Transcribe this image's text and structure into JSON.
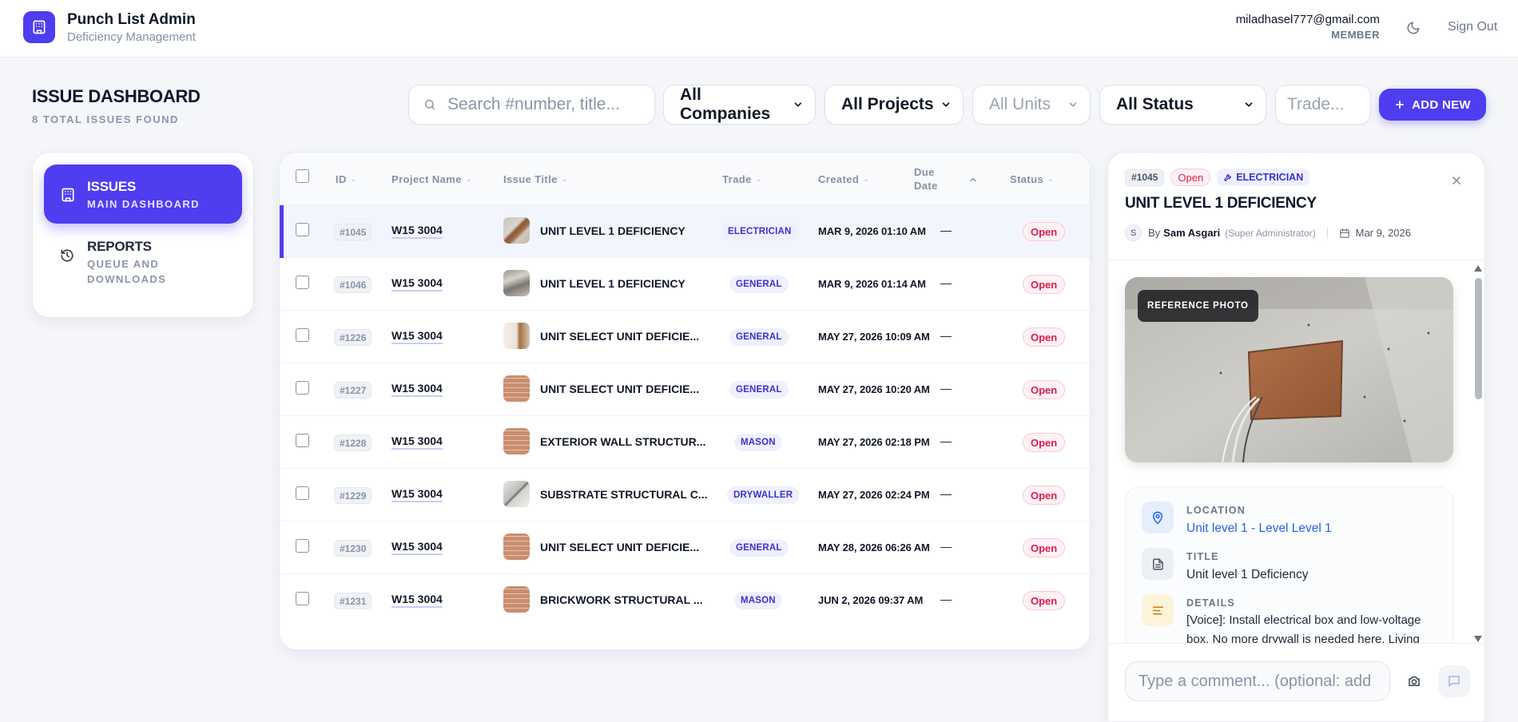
{
  "app": {
    "title": "Punch List Admin",
    "subtitle": "Deficiency Management",
    "user_email": "miladhasel777@gmail.com",
    "user_role": "MEMBER",
    "signout_label": "Sign Out"
  },
  "page": {
    "title": "ISSUE DASHBOARD",
    "count_label": "8 TOTAL ISSUES FOUND"
  },
  "filters": {
    "search_placeholder": "Search #number, title...",
    "companies": "All Companies",
    "projects": "All Projects",
    "units": "All Units",
    "status": "All Status",
    "trade_placeholder": "Trade...",
    "add_new_label": "ADD NEW"
  },
  "sidenav": {
    "items": [
      {
        "title": "ISSUES",
        "subtitle": "MAIN DASHBOARD",
        "icon": "building-icon",
        "active": true
      },
      {
        "title": "REPORTS",
        "subtitle": "QUEUE AND DOWNLOADS",
        "icon": "history-icon",
        "active": false
      }
    ]
  },
  "table": {
    "columns": {
      "id": "ID",
      "project": "Project Name",
      "title": "Issue Title",
      "trade": "Trade",
      "created": "Created",
      "due": "Due Date",
      "status": "Status"
    },
    "rows": [
      {
        "id": "#1045",
        "project": "W15 3004",
        "title": "UNIT LEVEL 1 DEFICIENCY",
        "trade": "ELECTRICIAN",
        "created": "MAR 9, 2026 01:10 AM",
        "due": "—",
        "status": "Open"
      },
      {
        "id": "#1046",
        "project": "W15 3004",
        "title": "UNIT LEVEL 1 DEFICIENCY",
        "trade": "GENERAL",
        "created": "MAR 9, 2026 01:14 AM",
        "due": "—",
        "status": "Open"
      },
      {
        "id": "#1226",
        "project": "W15 3004",
        "title": "UNIT SELECT UNIT DEFICIE...",
        "trade": "GENERAL",
        "created": "MAY 27, 2026 10:09 AM",
        "due": "—",
        "status": "Open"
      },
      {
        "id": "#1227",
        "project": "W15 3004",
        "title": "UNIT SELECT UNIT DEFICIE...",
        "trade": "GENERAL",
        "created": "MAY 27, 2026 10:20 AM",
        "due": "—",
        "status": "Open"
      },
      {
        "id": "#1228",
        "project": "W15 3004",
        "title": "EXTERIOR WALL STRUCTUR...",
        "trade": "MASON",
        "created": "MAY 27, 2026 02:18 PM",
        "due": "—",
        "status": "Open"
      },
      {
        "id": "#1229",
        "project": "W15 3004",
        "title": "SUBSTRATE STRUCTURAL C...",
        "trade": "DRYWALLER",
        "created": "MAY 27, 2026 02:24 PM",
        "due": "—",
        "status": "Open"
      },
      {
        "id": "#1230",
        "project": "W15 3004",
        "title": "UNIT SELECT UNIT DEFICIE...",
        "trade": "GENERAL",
        "created": "MAY 28, 2026 06:26 AM",
        "due": "—",
        "status": "Open"
      },
      {
        "id": "#1231",
        "project": "W15 3004",
        "title": "BRICKWORK STRUCTURAL ...",
        "trade": "MASON",
        "created": "JUN 2, 2026 09:37 AM",
        "due": "—",
        "status": "Open"
      }
    ]
  },
  "detail": {
    "id": "#1045",
    "status": "Open",
    "trade": "ELECTRICIAN",
    "title": "UNIT LEVEL 1 DEFICIENCY",
    "avatar_initial": "S",
    "by_label": "By",
    "author": "Sam Asgari",
    "author_role": "(Super Administrator)",
    "date": "Mar 9, 2026",
    "photo_label": "REFERENCE PHOTO",
    "location_label": "LOCATION",
    "location_value": "Unit level 1 - Level Level 1",
    "title_label": "TITLE",
    "title_value": "Unit level 1 Deficiency",
    "details_label": "DETAILS",
    "details_value": "[Voice]: Install electrical box and low-voltage box. No more drywall is needed here. Living",
    "comment_placeholder": "Type a comment... (optional: add"
  },
  "colors": {
    "accent": "#4f3df0",
    "status_open": "#dc1a4f",
    "link": "#2563eb"
  }
}
